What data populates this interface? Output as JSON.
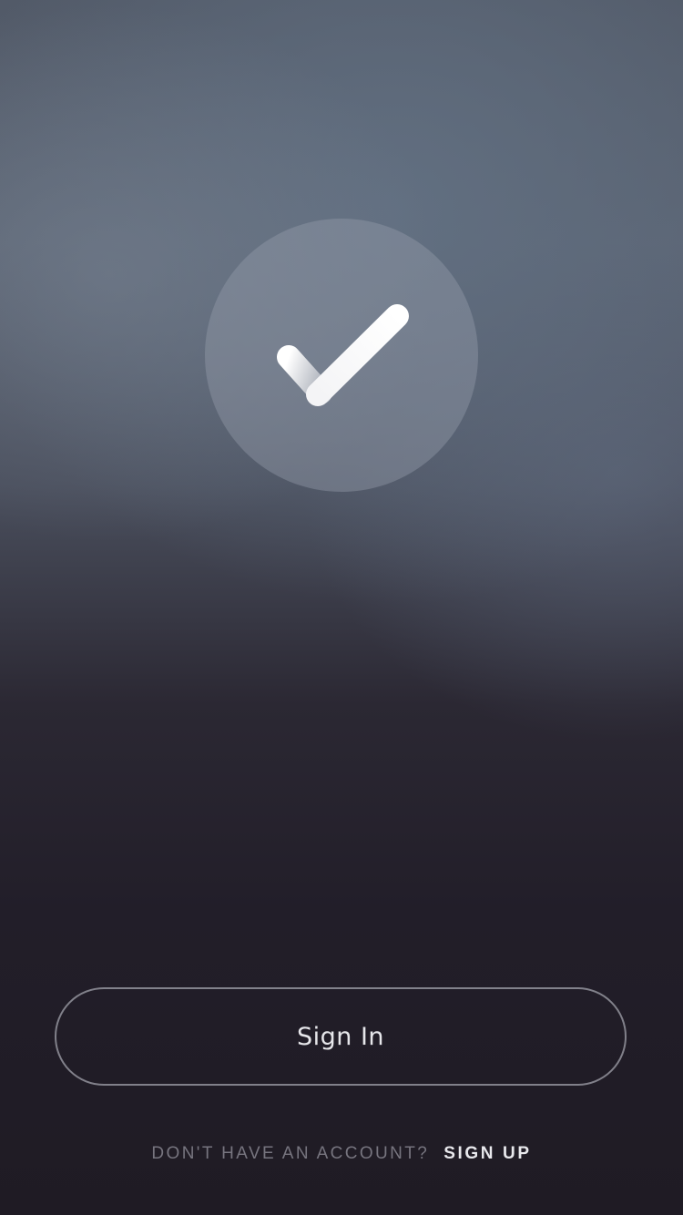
{
  "logo": {
    "icon": "checkmark-icon"
  },
  "auth": {
    "sign_in_label": "Sign In",
    "no_account_prompt": "DON'T HAVE AN ACCOUNT?",
    "sign_up_label": "SIGN UP"
  },
  "colors": {
    "background_top": "#5a6372",
    "background_bottom": "#1f1b24",
    "button_border": "#d2d4dc",
    "prompt_text": "#77757f",
    "link_text": "#e8e8ec"
  }
}
